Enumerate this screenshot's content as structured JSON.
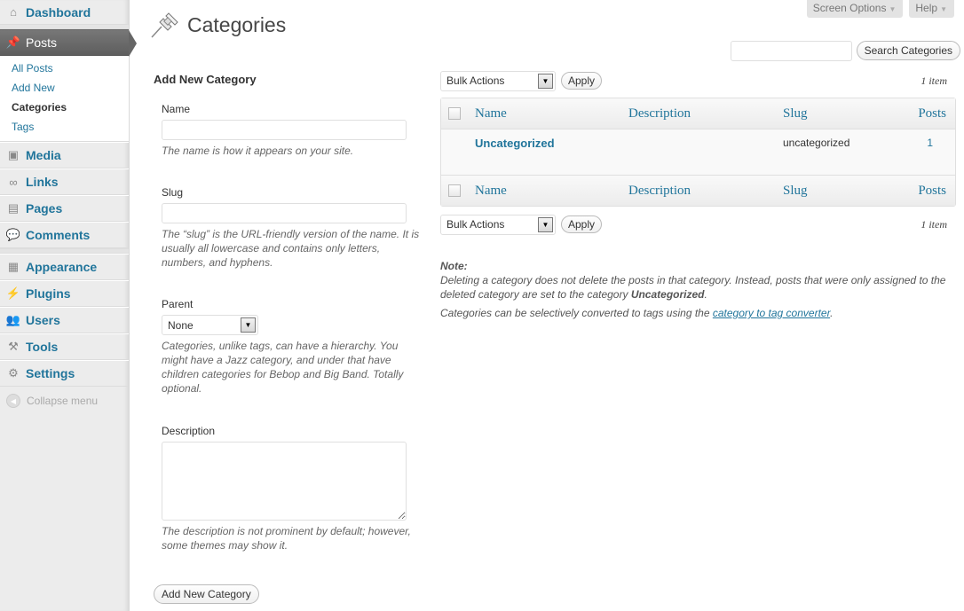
{
  "sidebar": {
    "items": [
      {
        "label": "Dashboard",
        "icon": "dashboard-icon"
      },
      {
        "label": "Posts",
        "icon": "pushpin-icon",
        "current": true,
        "submenu": [
          {
            "label": "All Posts"
          },
          {
            "label": "Add New"
          },
          {
            "label": "Categories",
            "current": true
          },
          {
            "label": "Tags"
          }
        ]
      },
      {
        "label": "Media",
        "icon": "media-icon"
      },
      {
        "label": "Links",
        "icon": "links-icon"
      },
      {
        "label": "Pages",
        "icon": "pages-icon"
      },
      {
        "label": "Comments",
        "icon": "comments-icon"
      },
      {
        "label": "Appearance",
        "icon": "appearance-icon"
      },
      {
        "label": "Plugins",
        "icon": "plugins-icon"
      },
      {
        "label": "Users",
        "icon": "users-icon"
      },
      {
        "label": "Tools",
        "icon": "tools-icon"
      },
      {
        "label": "Settings",
        "icon": "settings-icon"
      }
    ],
    "collapse_label": "Collapse menu"
  },
  "header": {
    "title": "Categories",
    "screen_options": "Screen Options",
    "help": "Help"
  },
  "search": {
    "value": "",
    "button": "Search Categories"
  },
  "form": {
    "heading": "Add New Category",
    "name_label": "Name",
    "name_value": "",
    "name_desc": "The name is how it appears on your site.",
    "slug_label": "Slug",
    "slug_value": "",
    "slug_desc": "The “slug” is the URL-friendly version of the name. It is usually all lowercase and contains only letters, numbers, and hyphens.",
    "parent_label": "Parent",
    "parent_value": "None",
    "parent_desc": "Categories, unlike tags, can have a hierarchy. You might have a Jazz category, and under that have children categories for Bebop and Big Band. Totally optional.",
    "description_label": "Description",
    "description_value": "",
    "description_desc": "The description is not prominent by default; however, some themes may show it.",
    "submit": "Add New Category"
  },
  "list": {
    "bulk_actions": "Bulk Actions",
    "apply": "Apply",
    "count": "1 item",
    "columns": [
      "Name",
      "Description",
      "Slug",
      "Posts"
    ],
    "rows": [
      {
        "name": "Uncategorized",
        "description": "",
        "slug": "uncategorized",
        "posts": "1"
      }
    ]
  },
  "notes": {
    "note_heading": "Note:",
    "note_text_1": "Deleting a category does not delete the posts in that category. Instead, posts that were only assigned to the deleted category are set to the category ",
    "note_bold": "Uncategorized",
    "note_text_2": ".",
    "convert_text": "Categories can be selectively converted to tags using the ",
    "convert_link": "category to tag converter",
    "convert_end": "."
  },
  "colors": {
    "link": "#21759b",
    "sidebar_bg": "#ececec",
    "current_menu_bg": "#666666"
  }
}
